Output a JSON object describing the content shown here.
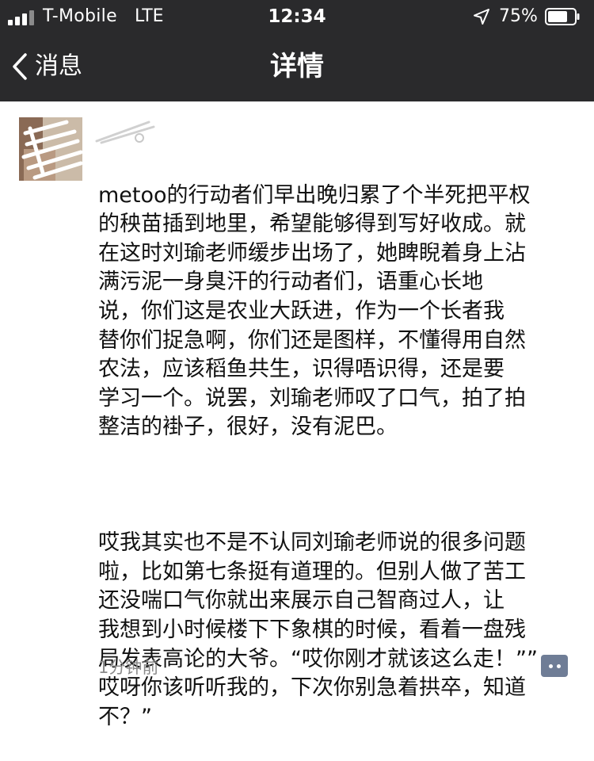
{
  "status_bar": {
    "carrier": "T-Mobile",
    "network": "LTE",
    "time": "12:34",
    "battery_percent": "75%",
    "battery_level": 0.75,
    "signal_bars": 3,
    "signal_bars_total": 4
  },
  "nav": {
    "back_label": "消息",
    "title": "详情"
  },
  "post": {
    "paragraph_1": "metoo的行动者们早出晚归累了个半死把平权\n的秧苗插到地里，希望能够得到写好收成。就\n在这时刘瑜老师缓步出场了，她睥睨着身上沾\n满污泥一身臭汗的行动者们，语重心长地\n说，你们这是农业大跃进，作为一个长者我\n替你们捉急啊，你们还是图样，不懂得用自然\n农法，应该稻鱼共生，识得唔识得，还是要\n学习一个。说罢，刘瑜老师叹了口气，拍了拍\n整洁的褂子，很好，没有泥巴。",
    "paragraph_2": "哎我其实也不是不认同刘瑜老师说的很多问题\n啦，比如第七条挺有道理的。但别人做了苦工\n还没喘口气你就出来展示自己智商过人，让\n我想到小时候楼下下象棋的时候，看着一盘残\n局发表高论的大爷。“哎你刚才就该这么走！””\n哎呀你该听听我的，下次你别急着拱卒，知道\n不？”",
    "timestamp": "1分钟前"
  },
  "icons": {
    "back": "chevron-left-icon",
    "location": "location-arrow-icon",
    "battery": "battery-icon",
    "signal": "signal-bars-icon",
    "comment": "comment-icon"
  },
  "colors": {
    "topbar_bg": "#2a2a2c",
    "text": "#111111",
    "timestamp": "#8a8a8a",
    "comment_button": "#6f7d96"
  }
}
